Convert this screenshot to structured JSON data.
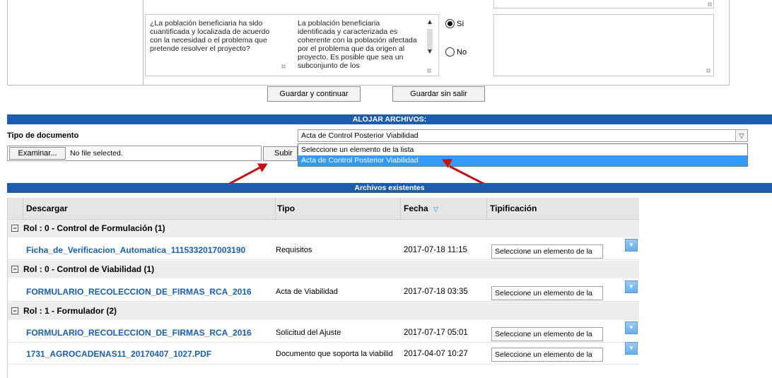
{
  "question": {
    "text": "¿La población beneficiaria ha sido cuantificada y localizada de acuerdo con la necesidad o el problema que pretende resolver el proyecto?",
    "answer": "La población beneficiaria identificada y caracterizada es coherente con la población afectada por el problema que da origen al proyecto. Es posible que sea un subconjunto de los",
    "options": {
      "yes": "Sí",
      "no": "No"
    },
    "selected": "yes"
  },
  "actions": {
    "save_continue": "Guardar y continuar",
    "save_stay": "Guardar sin salir"
  },
  "upload": {
    "banner": "ALOJAR ARCHIVOS:",
    "doc_type_label": "Tipo de documento",
    "doc_type_value": "Acta de Control Posterior Viabilidad",
    "dropdown_options": [
      "Seleccione un elemento de la lista",
      "Acta de Control Posterior Viabilidad"
    ],
    "browse_label": "Examinar...",
    "file_status": "No file selected.",
    "upload_label": "Subir A"
  },
  "files": {
    "banner": "Archivos existentes",
    "columns": [
      "Descargar",
      "Tipo",
      "Fecha",
      "Tipificación"
    ],
    "groups": [
      {
        "title": "Rol : 0 - Control de Formulación (1)",
        "rows": [
          {
            "name": "Ficha_de_Verificacion_Automatica_1115332017003190",
            "tipo": "Requisitos",
            "fecha": "2017-07-18 11:15",
            "tip": "Seleccione un elemento de la"
          }
        ]
      },
      {
        "title": "Rol : 0 - Control de Viabilidad (1)",
        "rows": [
          {
            "name": "FORMULARIO_RECOLECCION_DE_FIRMAS_RCA_2016",
            "tipo": "Acta de Viabilidad",
            "fecha": "2017-07-18 03:35",
            "tip": "Seleccione un elemento de la"
          }
        ]
      },
      {
        "title": "Rol : 1 - Formulador (2)",
        "rows": [
          {
            "name": "FORMULARIO_RECOLECCION_DE_FIRMAS_RCA_2016",
            "tipo": "Solicitud del Ajuste",
            "fecha": "2017-07-17 05:01",
            "tip": "Seleccione un elemento de la"
          },
          {
            "name": "1731_AGROCADENAS11_20170407_1027.PDF",
            "tipo": "Documento que soporta la viabilid",
            "fecha": "2017-04-07 10:27",
            "tip": "Seleccione un elemento de la"
          }
        ]
      }
    ]
  },
  "colors": {
    "banner": "#1d5dab",
    "link": "#1a5fae",
    "selection": "#3399ff",
    "annotation_arrow": "#c0101a"
  }
}
